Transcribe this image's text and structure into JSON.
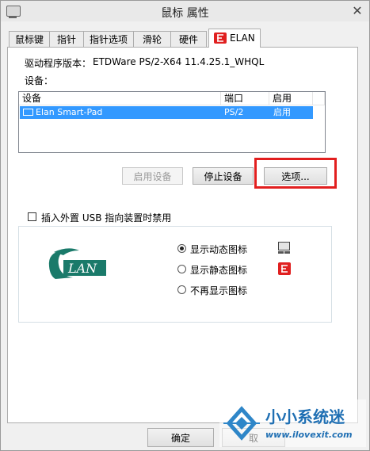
{
  "window": {
    "title": "鼠标 属性",
    "close_label": "✕"
  },
  "tabs": [
    {
      "label": "鼠标键"
    },
    {
      "label": "指针"
    },
    {
      "label": "指针选项"
    },
    {
      "label": "滑轮"
    },
    {
      "label": "硬件"
    },
    {
      "label": "ELAN"
    }
  ],
  "driver": {
    "label": "驱动程序版本：",
    "value": "ETDWare PS/2-X64 11.4.25.1_WHQL"
  },
  "devices": {
    "label": "设备：",
    "columns": [
      "设备",
      "端口",
      "启用"
    ],
    "rows": [
      {
        "device": "Elan Smart-Pad",
        "port": "PS/2",
        "enabled": "启用"
      }
    ]
  },
  "buttons": {
    "enable": "启用设备",
    "disable": "停止设备",
    "options": "选项..."
  },
  "usb_checkbox": {
    "label": "插入外置 USB 指向装置时禁用",
    "checked": false
  },
  "icon_options": {
    "selected": "show_dynamic",
    "options": [
      {
        "label": "显示动态图标"
      },
      {
        "label": "显示静态图标"
      },
      {
        "label": "不再显示图标"
      }
    ]
  },
  "logo": {
    "text": "LAN",
    "letter": "E"
  },
  "footer": {
    "ok": "确定",
    "cancel": "取"
  },
  "watermark": {
    "text": "小小系统迷",
    "url": "www.ilovexit.com"
  }
}
